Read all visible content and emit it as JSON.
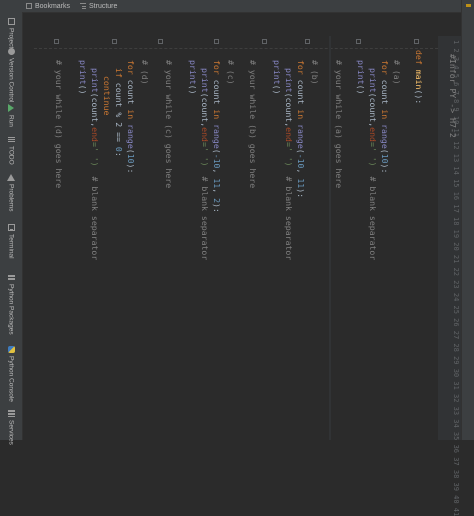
{
  "toolbar": {
    "bookmarks_label": "Bookmarks",
    "structure_label": "Structure"
  },
  "sidebar": {
    "items": [
      {
        "label": "Project",
        "icon": "folder-icon"
      },
      {
        "label": "Version Control",
        "icon": "branch-icon"
      },
      {
        "label": "Run",
        "icon": "run-icon"
      },
      {
        "label": "TODO",
        "icon": "list-icon"
      },
      {
        "label": "Problems",
        "icon": "problems-icon"
      },
      {
        "label": "Terminal",
        "icon": "terminal-icon"
      },
      {
        "label": "Python Packages",
        "icon": "layers-icon"
      },
      {
        "label": "Python Console",
        "icon": "python-icon"
      },
      {
        "label": "Services",
        "icon": "services-icon"
      }
    ]
  },
  "editor": {
    "header_comment": "#Infor PY -> H7-2",
    "line_numbers": [
      "1",
      "2",
      "3",
      "4",
      "5",
      "6",
      "7",
      "8",
      "9",
      "10",
      "11",
      "12",
      "13",
      "14",
      "15",
      "16",
      "17",
      "18",
      "19",
      "20",
      "21",
      "22",
      "23",
      "24",
      "25",
      "26",
      "27",
      "28",
      "29",
      "30",
      "31",
      "32",
      "33",
      "34",
      "35",
      "36",
      "37",
      "38",
      "39",
      "40",
      "41"
    ],
    "lines": {
      "def": "def",
      "main": "main",
      "def_rest": "():",
      "c_a": "# (a)",
      "c_while_a": "# your while (a) goes here",
      "c_b": "# (b)",
      "c_while_b": "# your while (b) goes here",
      "c_c": "# (c)",
      "c_while_c": "# your while (c) goes here",
      "c_d": "# (d)",
      "c_while_d": "# your while (d) goes here",
      "for": "for",
      "count": " count ",
      "in": "in",
      "range": " range",
      "open": "(",
      "close": "):",
      "print": "print",
      "print_open": "(count,",
      "end_kw": "end",
      "end_val": "=' ')",
      "blank_sep": "# blank separator",
      "print_empty": "()",
      "if": "if",
      "mod_expr": " count % 2 == ",
      "colon": ":",
      "continue": "continue",
      "comma": ", ",
      "a_args": [
        "10"
      ],
      "b_args": [
        "-10",
        "11"
      ],
      "c_args": [
        "-10",
        "11",
        "2"
      ],
      "d_args": [
        "10"
      ],
      "zero": "0"
    }
  },
  "colors": {
    "background": "#2b2b2b",
    "keyword": "#cc7832",
    "function": "#ffc66d",
    "builtin": "#8888c6",
    "number": "#6897bb",
    "string": "#6a8759",
    "comment": "#808080"
  }
}
